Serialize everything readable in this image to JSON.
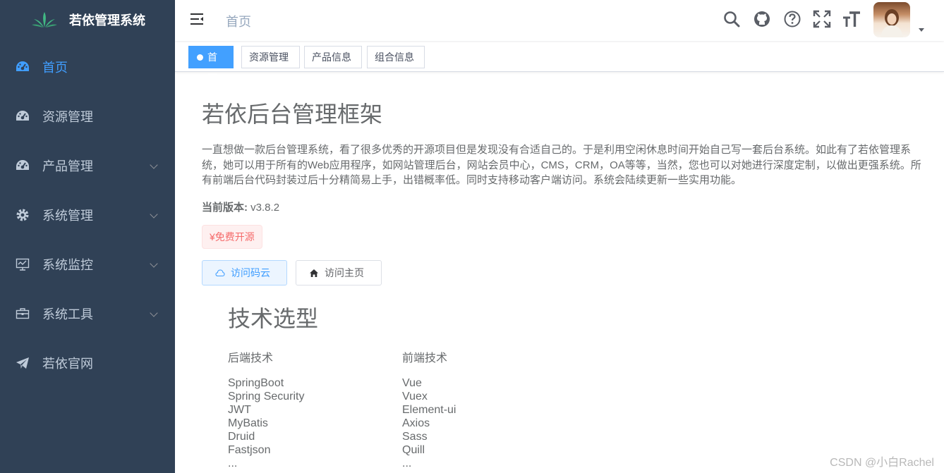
{
  "sidebar": {
    "logo_title": "若依管理系统",
    "items": [
      {
        "label": "首页",
        "icon": "dashboard-icon",
        "active": true
      },
      {
        "label": "资源管理",
        "icon": "dashboard-icon"
      },
      {
        "label": "产品管理",
        "icon": "dashboard-icon"
      },
      {
        "label": "系统管理",
        "icon": "gear-icon"
      },
      {
        "label": "系统监控",
        "icon": "monitor-icon"
      },
      {
        "label": "系统工具",
        "icon": "toolbox-icon"
      },
      {
        "label": "若依官网",
        "icon": "paper-plane-icon"
      }
    ]
  },
  "navbar": {
    "breadcrumb": "首页",
    "icons": [
      "search-icon",
      "github-icon",
      "question-icon",
      "fullscreen-icon",
      "font-size-icon"
    ]
  },
  "tags": [
    "首页",
    "资源管理",
    "产品信息",
    "组合信息"
  ],
  "main": {
    "title": "若依后台管理框架",
    "intro": "一直想做一款后台管理系统，看了很多优秀的开源项目但是发现没有合适自己的。于是利用空闲休息时间开始自己写一套后台系统。如此有了若依管理系统，她可以用于所有的Web应用程序，如网站管理后台，网站会员中心，CMS，CRM，OA等等，当然，您也可以对她进行深度定制，以做出更强系统。所有前端后台代码封装过后十分精简易上手，出错概率低。同时支持移动客户端访问。系统会陆续更新一些实用功能。",
    "version_label": "当前版本:",
    "version_value": "v3.8.2",
    "free_tag": "¥免费开源",
    "btn_gitee": "访问码云",
    "btn_home": "访问主页",
    "tech_title": "技术选型",
    "backend_title": "后端技术",
    "frontend_title": "前端技术",
    "backend": [
      "SpringBoot",
      "Spring Security",
      "JWT",
      "MyBatis",
      "Druid",
      "Fastjson",
      "..."
    ],
    "frontend": [
      "Vue",
      "Vuex",
      "Element-ui",
      "Axios",
      "Sass",
      "Quill",
      "..."
    ]
  },
  "watermark": "CSDN @小白Rachel",
  "colors": {
    "sidebar_bg": "#304156",
    "accent": "#409eff",
    "tag_active": "#42a0ff"
  }
}
